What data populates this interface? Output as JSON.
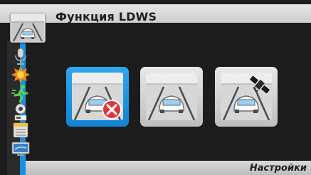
{
  "header": {
    "title": "Функция LDWS",
    "icon": "lane-car-icon"
  },
  "sidebar": {
    "items": [
      {
        "icon": "microphone-icon"
      },
      {
        "icon": "brightness-icon"
      },
      {
        "icon": "motion-runner-icon"
      },
      {
        "icon": "battery-icon"
      },
      {
        "icon": "memory-card-icon"
      },
      {
        "icon": "monitor-icon"
      }
    ]
  },
  "options": [
    {
      "icon": "lane-car-off-icon",
      "state": "selected"
    },
    {
      "icon": "lane-car-icon",
      "state": "normal"
    },
    {
      "icon": "lane-car-gps-icon",
      "state": "normal"
    }
  ],
  "footer": {
    "label": "Настройки"
  },
  "colors": {
    "accent": "#1a8fe0",
    "background": "#1c1c1c",
    "bar": "#d0d0d0",
    "error": "#e2333b"
  }
}
